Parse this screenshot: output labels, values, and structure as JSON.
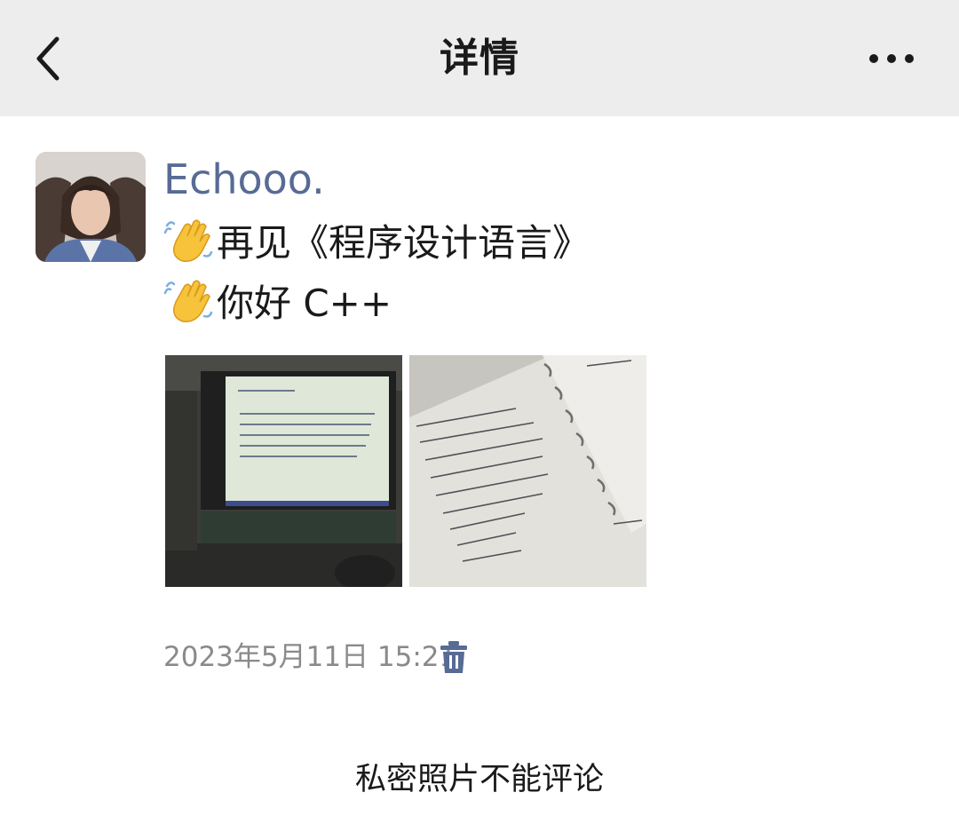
{
  "header": {
    "title": "详情",
    "back_icon": "chevron-left-icon",
    "more_icon": "more-dots-icon"
  },
  "post": {
    "username": "Echooo.",
    "lines": [
      {
        "emoji": "waving-hand",
        "text": "再见《程序设计语言》"
      },
      {
        "emoji": "waving-hand",
        "text": "你好  C++"
      }
    ],
    "photos": [
      {
        "name": "projector-screen-photo"
      },
      {
        "name": "handwritten-notebook-photo"
      }
    ],
    "timestamp": "2023年5月11日 15:21",
    "delete_icon": "trash-icon"
  },
  "footer": {
    "notice": "私密照片不能评论"
  },
  "colors": {
    "navbar_bg": "#ededed",
    "username": "#576b95",
    "timestamp": "#8a8a8a",
    "trash": "#576b95"
  }
}
